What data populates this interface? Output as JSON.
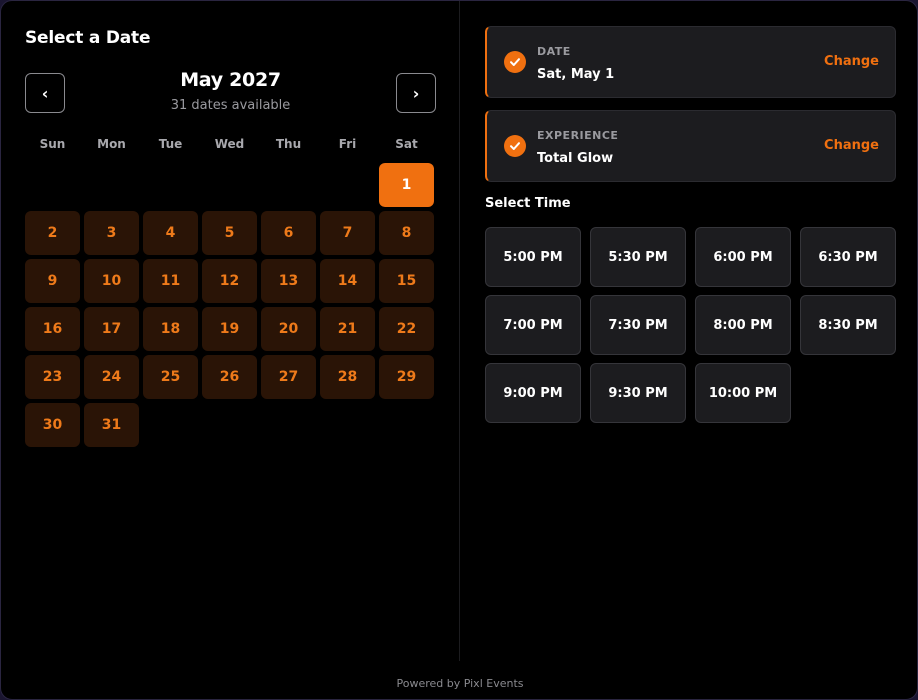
{
  "calendar": {
    "title": "Select a Date",
    "prev_icon": "‹",
    "next_icon": "›",
    "month_label": "May 2027",
    "availability": "31 dates available",
    "weekdays": [
      "Sun",
      "Mon",
      "Tue",
      "Wed",
      "Thu",
      "Fri",
      "Sat"
    ],
    "leading_blanks": 6,
    "days": [
      "1",
      "2",
      "3",
      "4",
      "5",
      "6",
      "7",
      "8",
      "9",
      "10",
      "11",
      "12",
      "13",
      "14",
      "15",
      "16",
      "17",
      "18",
      "19",
      "20",
      "21",
      "22",
      "23",
      "24",
      "25",
      "26",
      "27",
      "28",
      "29",
      "30",
      "31"
    ],
    "selected_day": "1"
  },
  "summary": {
    "date": {
      "label": "DATE",
      "value": "Sat, May 1",
      "change": "Change"
    },
    "experience": {
      "label": "EXPERIENCE",
      "value": "Total Glow",
      "change": "Change"
    }
  },
  "times": {
    "title": "Select Time",
    "slots": [
      "5:00 PM",
      "5:30 PM",
      "6:00 PM",
      "6:30 PM",
      "7:00 PM",
      "7:30 PM",
      "8:00 PM",
      "8:30 PM",
      "9:00 PM",
      "9:30 PM",
      "10:00 PM"
    ]
  },
  "footer": {
    "text": "Powered by Pixl Events"
  },
  "colors": {
    "accent": "#f07010",
    "day_bg": "#2a1406",
    "card_bg": "#1c1c1f",
    "background": "#000000"
  }
}
